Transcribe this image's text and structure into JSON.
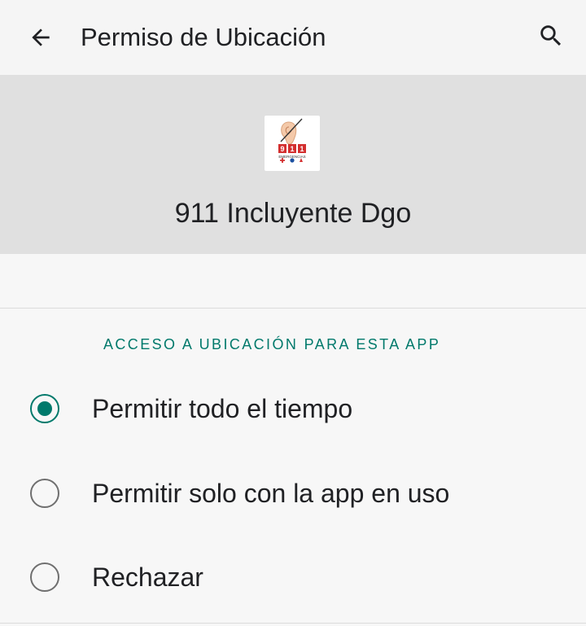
{
  "app_bar": {
    "title": "Permiso de Ubicación",
    "back_icon": "arrow-back-icon",
    "search_icon": "search-icon"
  },
  "app_info": {
    "name": "911 Incluyente Dgo",
    "icon_text": "911",
    "icon_subtext": "EMERGENCIAS"
  },
  "section": {
    "label": "ACCESO A UBICACIÓN PARA ESTA APP"
  },
  "options": [
    {
      "label": "Permitir todo el tiempo",
      "selected": true
    },
    {
      "label": "Permitir solo con la app en uso",
      "selected": false
    },
    {
      "label": "Rechazar",
      "selected": false
    }
  ],
  "colors": {
    "accent": "#00796b",
    "header_bg": "#e0e0e0",
    "page_bg": "#f7f7f7"
  }
}
